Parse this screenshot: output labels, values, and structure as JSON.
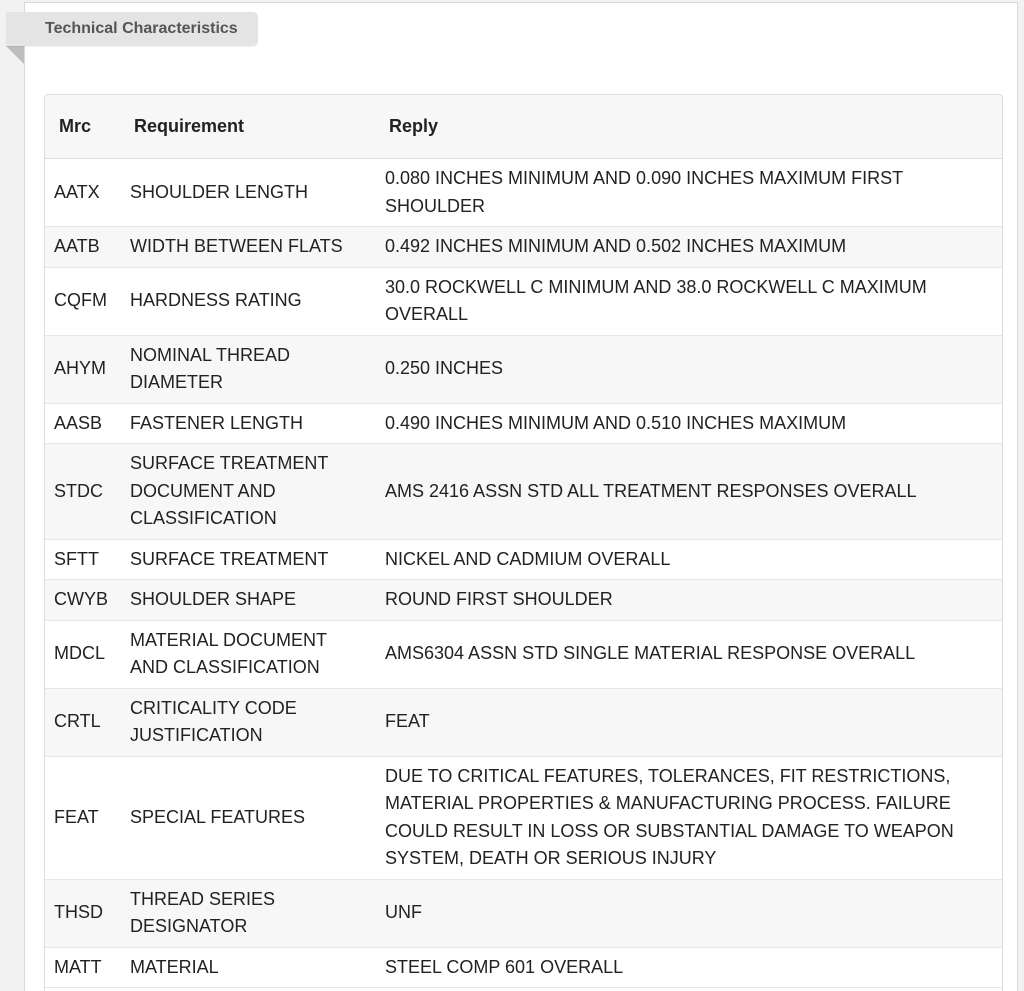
{
  "section": {
    "title": "Technical Characteristics"
  },
  "table": {
    "headers": {
      "mrc": "Mrc",
      "requirement": "Requirement",
      "reply": "Reply"
    },
    "rows": [
      {
        "mrc": "AATX",
        "requirement": "SHOULDER LENGTH",
        "reply": "0.080 INCHES MINIMUM AND 0.090 INCHES MAXIMUM FIRST SHOULDER"
      },
      {
        "mrc": "AATB",
        "requirement": "WIDTH BETWEEN FLATS",
        "reply": "0.492 INCHES MINIMUM AND 0.502 INCHES MAXIMUM"
      },
      {
        "mrc": "CQFM",
        "requirement": "HARDNESS RATING",
        "reply": "30.0 ROCKWELL C MINIMUM AND 38.0 ROCKWELL C MAXIMUM OVERALL"
      },
      {
        "mrc": "AHYM",
        "requirement": "NOMINAL THREAD DIAMETER",
        "reply": "0.250 INCHES"
      },
      {
        "mrc": "AASB",
        "requirement": "FASTENER LENGTH",
        "reply": "0.490 INCHES MINIMUM AND 0.510 INCHES MAXIMUM"
      },
      {
        "mrc": "STDC",
        "requirement": "SURFACE TREATMENT DOCUMENT AND CLASSIFICATION",
        "reply": "AMS 2416 ASSN STD ALL TREATMENT RESPONSES OVERALL"
      },
      {
        "mrc": "SFTT",
        "requirement": "SURFACE TREATMENT",
        "reply": "NICKEL AND CADMIUM OVERALL"
      },
      {
        "mrc": "CWYB",
        "requirement": "SHOULDER SHAPE",
        "reply": "ROUND FIRST SHOULDER"
      },
      {
        "mrc": "MDCL",
        "requirement": "MATERIAL DOCUMENT AND CLASSIFICATION",
        "reply": "AMS6304 ASSN STD SINGLE MATERIAL RESPONSE OVERALL"
      },
      {
        "mrc": "CRTL",
        "requirement": "CRITICALITY CODE JUSTIFICATION",
        "reply": "FEAT"
      },
      {
        "mrc": "FEAT",
        "requirement": "SPECIAL FEATURES",
        "reply": "DUE TO CRITICAL FEATURES, TOLERANCES, FIT RESTRICTIONS, MATERIAL PROPERTIES & MANUFACTURING PROCESS. FAILURE COULD RESULT IN LOSS OR SUBSTANTIAL DAMAGE TO WEAPON SYSTEM, DEATH OR SERIOUS INJURY"
      },
      {
        "mrc": "THSD",
        "requirement": "THREAD SERIES DESIGNATOR",
        "reply": "UNF"
      },
      {
        "mrc": "MATT",
        "requirement": "MATERIAL",
        "reply": "STEEL COMP 601 OVERALL"
      }
    ]
  }
}
